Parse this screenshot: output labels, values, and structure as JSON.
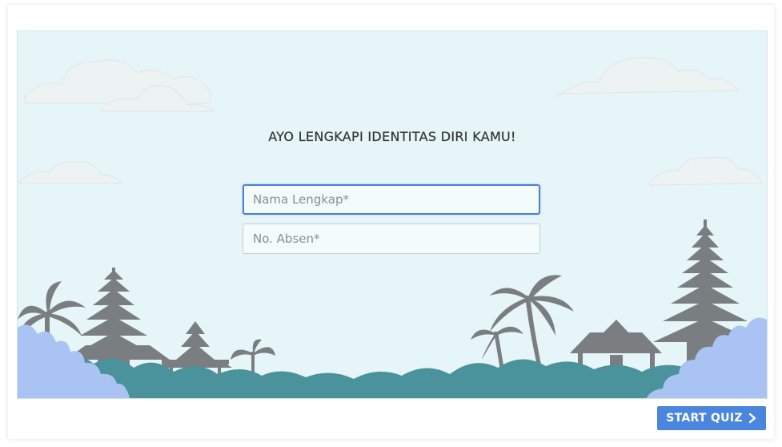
{
  "form": {
    "heading": "AYO LENGKAPI IDENTITAS DIRI KAMU!",
    "name_field": {
      "placeholder": "Nama Lengkap*",
      "value": ""
    },
    "number_field": {
      "placeholder": "No. Absen*",
      "value": ""
    }
  },
  "footer": {
    "start_label": "START QUIZ",
    "start_icon": "chevron-right-icon"
  },
  "colors": {
    "sky": "#e6f5f7",
    "clouds": "#eef3f4",
    "silhouette": "#7a7e80",
    "foliage_teal": "#4b939c",
    "foliage_blue": "#a9c4f2",
    "accent_button": "#4a86dd",
    "focus_border": "#4c7fd6"
  }
}
